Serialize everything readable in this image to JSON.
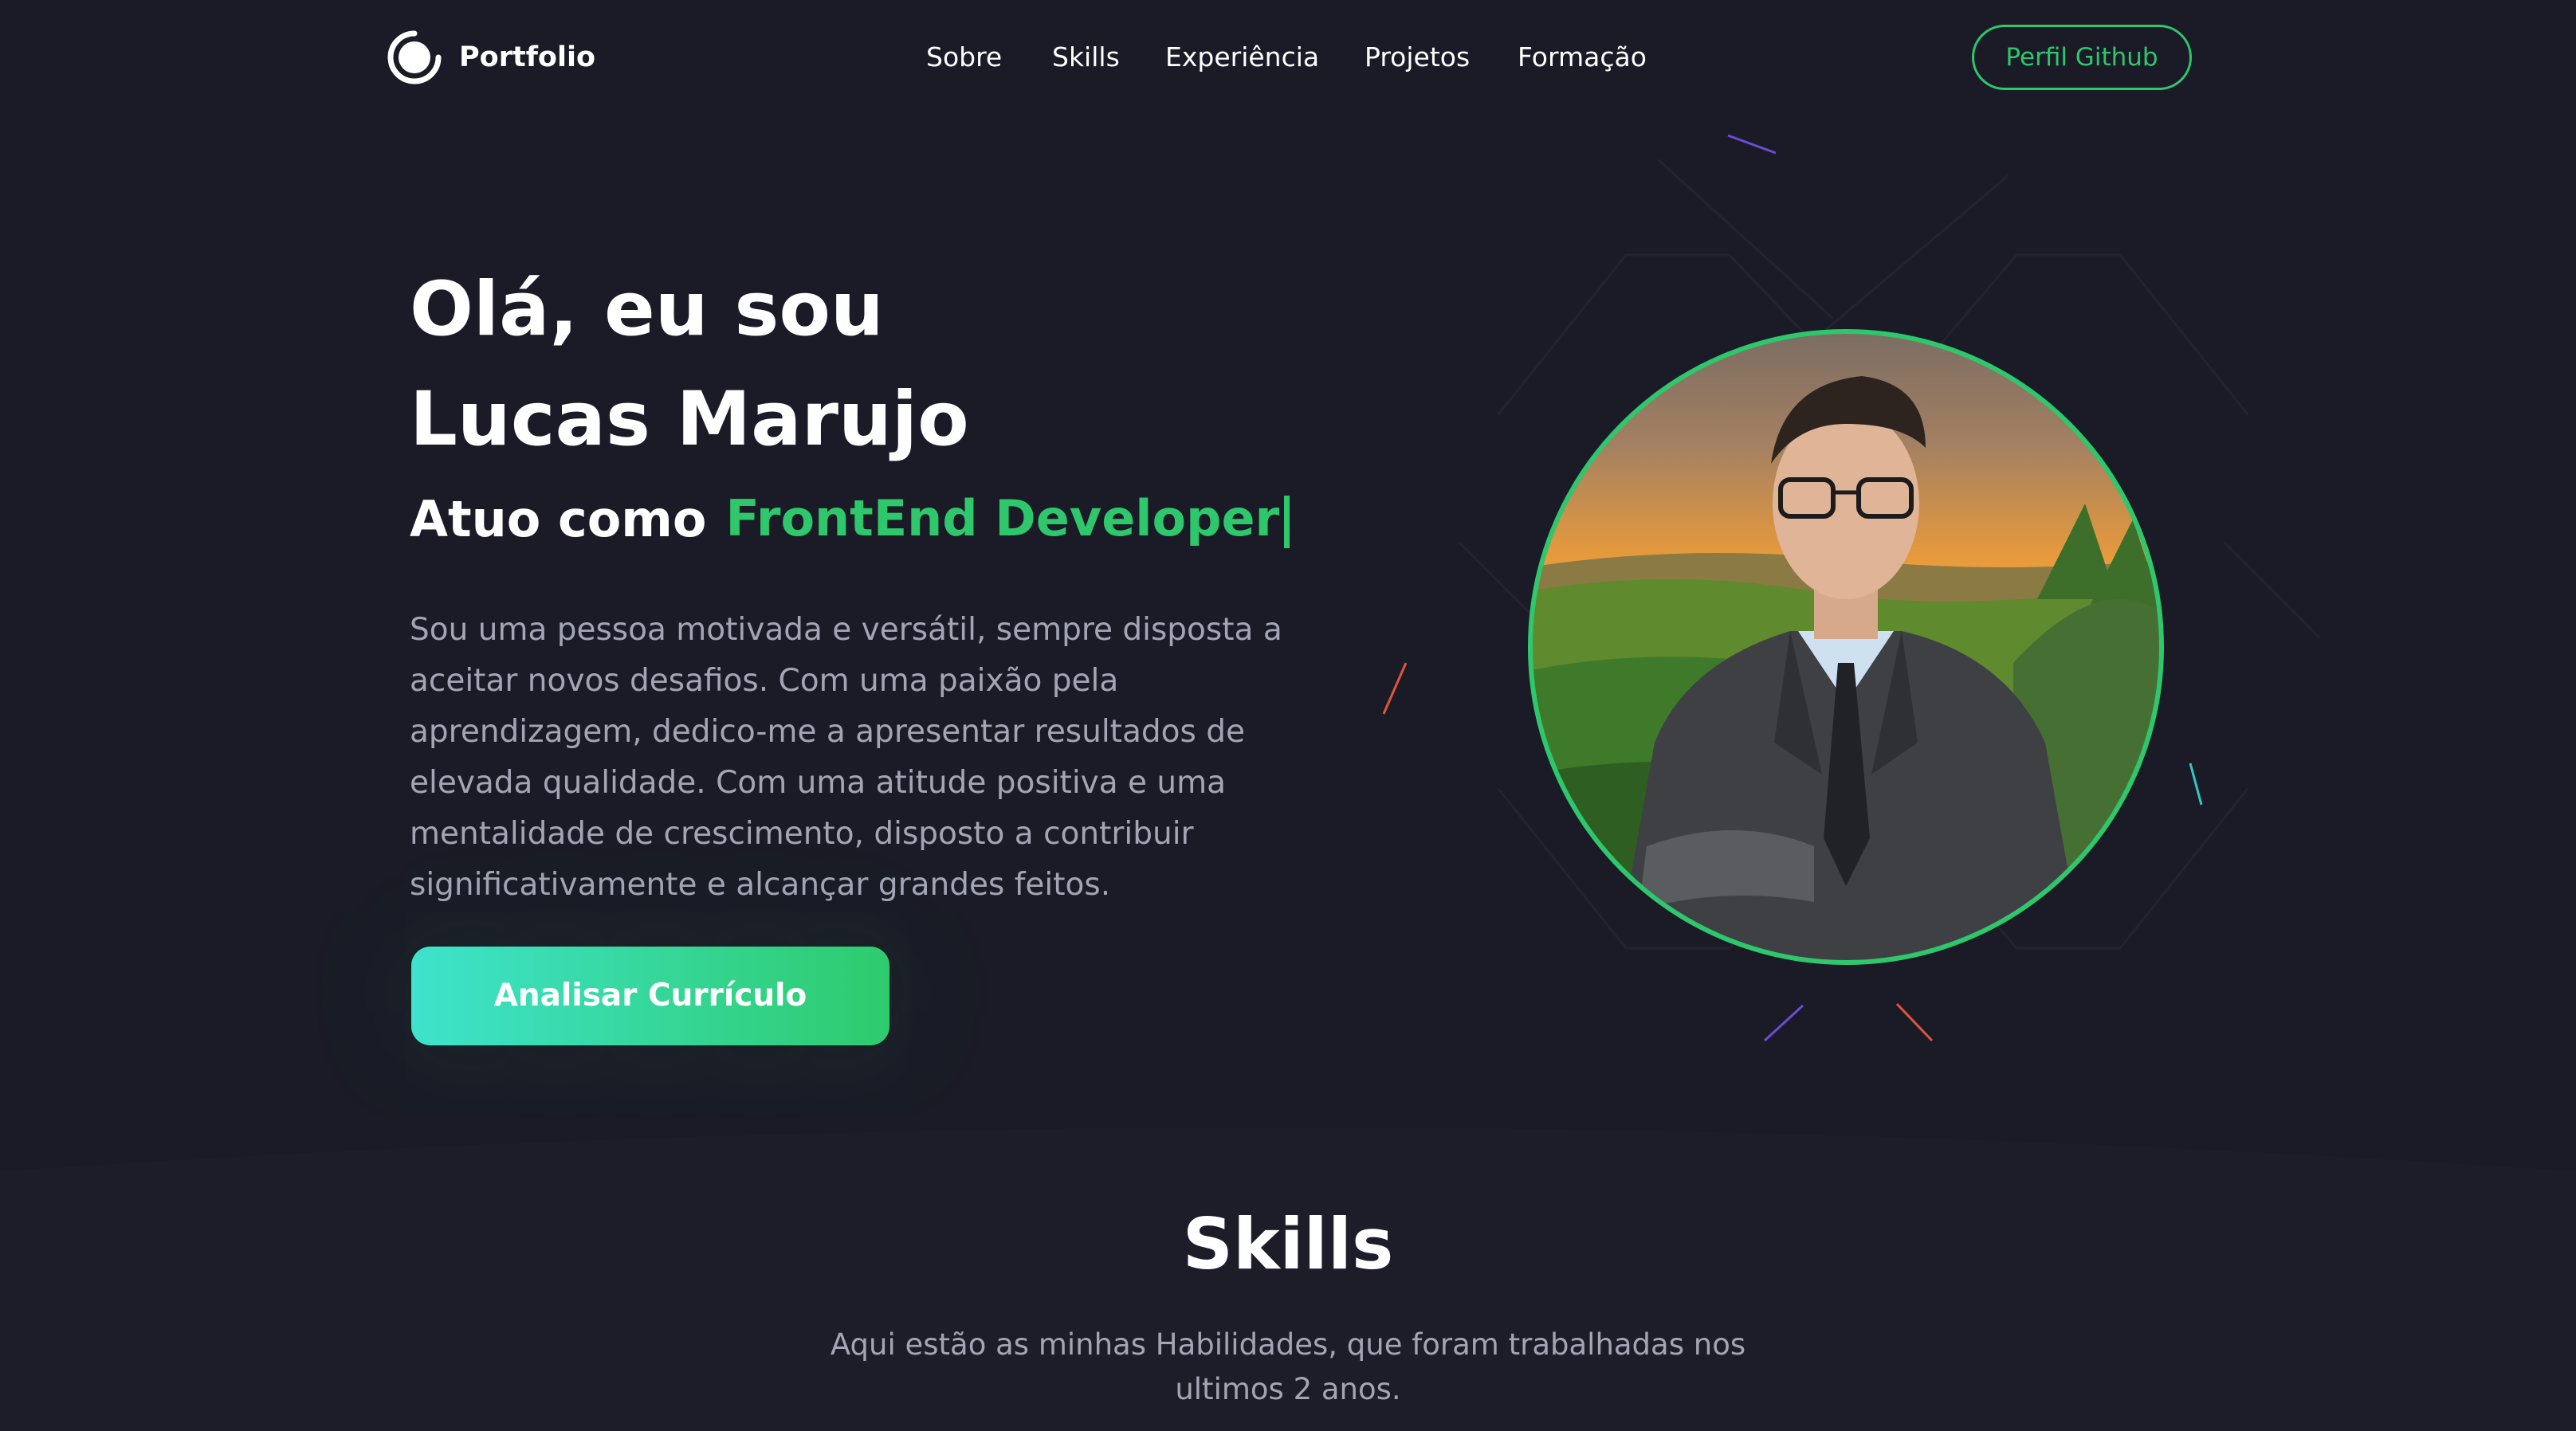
{
  "header": {
    "logo_text": "Portfolio",
    "nav": [
      "Sobre",
      "Skills",
      "Experiência",
      "Projetos",
      "Formação"
    ],
    "github_button": "Perfil Github"
  },
  "hero": {
    "greeting_line1": "Olá, eu sou",
    "greeting_line2": "Lucas Marujo",
    "role_prefix": "Atuo como",
    "role_value": "FrontEnd Developer",
    "bio": "Sou uma pessoa motivada e versátil, sempre disposta a aceitar novos desafios. Com uma paixão pela aprendizagem, dedico-me a apresentar resultados de elevada qualidade. Com uma atitude positiva e uma mentalidade de crescimento, disposto a contribuir significativamente e alcançar grandes feitos.",
    "cta": "Analisar Currículo"
  },
  "skills": {
    "title": "Skills",
    "subtitle": "Aqui estão as minhas Habilidades, que foram trabalhadas nos ultimos 2 anos."
  },
  "colors": {
    "background": "#1a1b26",
    "accent": "#2ec76c",
    "gradient_start": "#3ee3cc",
    "muted_text": "#a3a5b4"
  },
  "icons": {
    "logo": "portfolio-logo-icon"
  }
}
